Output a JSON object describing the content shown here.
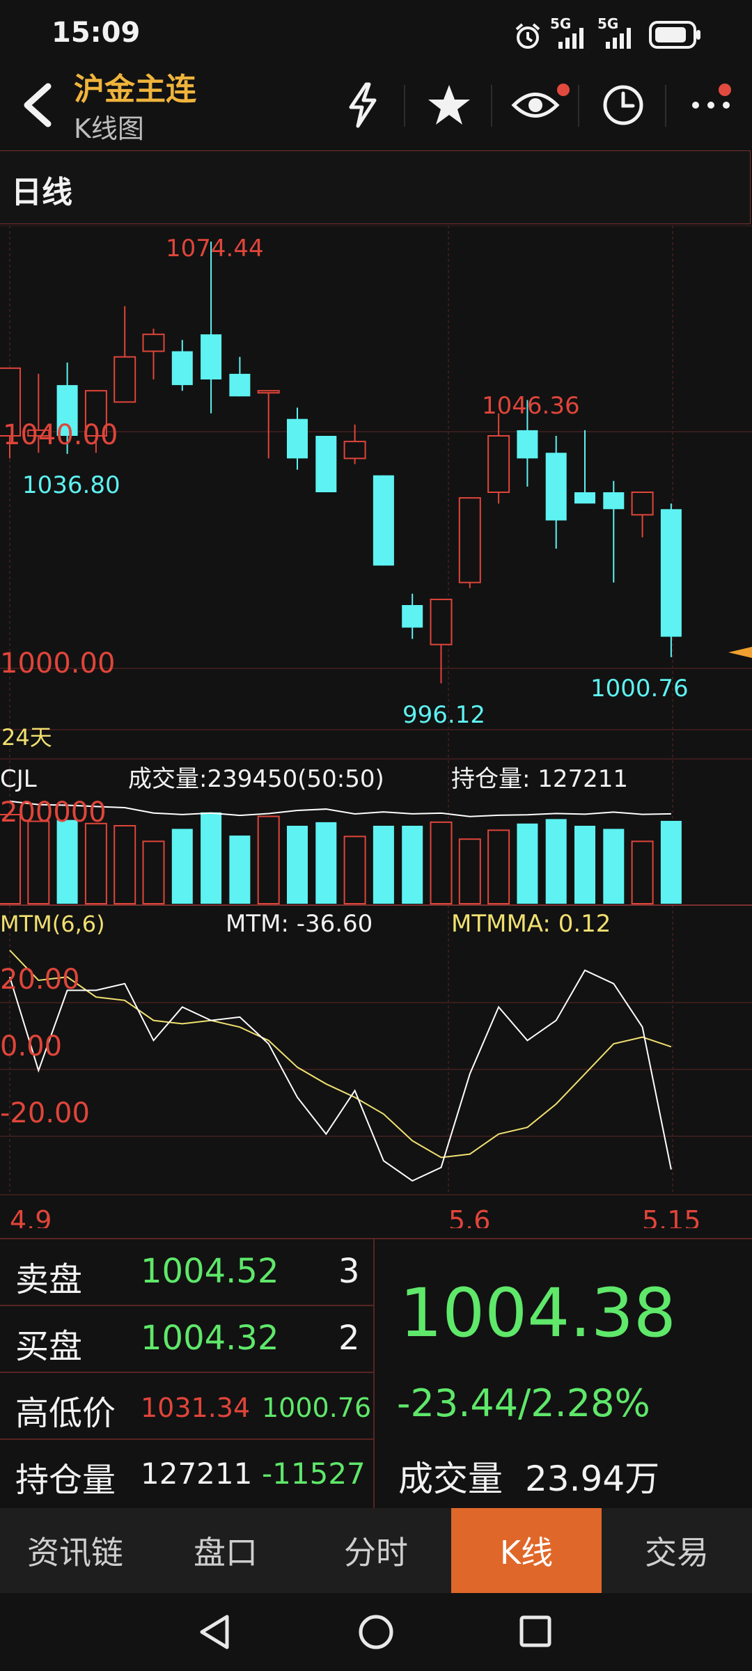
{
  "status_bar": {
    "time": "15:09",
    "network_1": "5G",
    "network_2": "5G"
  },
  "header": {
    "title": "沪金主连",
    "subtitle": "K线图",
    "icons": [
      "back-icon",
      "flash-icon",
      "star-icon",
      "eye-icon",
      "clock-icon",
      "more-icon"
    ]
  },
  "period": {
    "label": "日线"
  },
  "chart": {
    "price_labels": {
      "high": "1074.44",
      "level_1040": "1040.00",
      "low_left": "1036.80",
      "high2": "1046.36",
      "level_1000": "1000.00",
      "low": "996.12",
      "last_low": "1000.76"
    },
    "days_label": "24天",
    "volume": {
      "name": "CJL",
      "volume_text": "成交量:239450(50:50)",
      "oi_text": "持仓量: 127211",
      "axis_label": "200000"
    },
    "mtm": {
      "name": "MTM(6,6)",
      "mtm_text": "MTM: -36.60",
      "mtmma_text": "MTMMA: 0.12",
      "ticks": [
        "20.00",
        "0.00",
        "-20.00"
      ]
    },
    "date_labels": [
      "4.9",
      "5.6",
      "5.15"
    ]
  },
  "chart_data": {
    "type": "candlestick",
    "ohlc": [
      {
        "o": 1040,
        "h": 1045,
        "l": 1036,
        "c": 1052
      },
      {
        "o": 1040,
        "h": 1051,
        "l": 1037,
        "c": 1041
      },
      {
        "o": 1049,
        "h": 1053,
        "l": 1036.8,
        "c": 1040
      },
      {
        "o": 1040,
        "h": 1047,
        "l": 1037,
        "c": 1048
      },
      {
        "o": 1046,
        "h": 1063,
        "l": 1046,
        "c": 1054
      },
      {
        "o": 1055,
        "h": 1059,
        "l": 1050,
        "c": 1058
      },
      {
        "o": 1055,
        "h": 1057,
        "l": 1048,
        "c": 1049
      },
      {
        "o": 1058,
        "h": 1074.44,
        "l": 1044,
        "c": 1050
      },
      {
        "o": 1051,
        "h": 1054,
        "l": 1047,
        "c": 1047
      },
      {
        "o": 1048,
        "h": 1048,
        "l": 1036,
        "c": 1048
      },
      {
        "o": 1043,
        "h": 1045,
        "l": 1034,
        "c": 1036
      },
      {
        "o": 1040,
        "h": 1040,
        "l": 1030,
        "c": 1030
      },
      {
        "o": 1036,
        "h": 1042,
        "l": 1035,
        "c": 1039
      },
      {
        "o": 1033,
        "h": 1033,
        "l": 1017,
        "c": 1017
      },
      {
        "o": 1010,
        "h": 1012,
        "l": 1004,
        "c": 1006
      },
      {
        "o": 1003,
        "h": 1011,
        "l": 996.12,
        "c": 1011
      },
      {
        "o": 1014,
        "h": 1029,
        "l": 1013,
        "c": 1029
      },
      {
        "o": 1030,
        "h": 1044,
        "l": 1028,
        "c": 1040
      },
      {
        "o": 1041,
        "h": 1046.36,
        "l": 1031,
        "c": 1036
      },
      {
        "o": 1037,
        "h": 1040,
        "l": 1020,
        "c": 1025
      },
      {
        "o": 1030,
        "h": 1041,
        "l": 1029,
        "c": 1028
      },
      {
        "o": 1030,
        "h": 1032,
        "l": 1014,
        "c": 1027
      },
      {
        "o": 1026,
        "h": 1030,
        "l": 1022,
        "c": 1030
      },
      {
        "o": 1027,
        "h": 1028,
        "l": 1000.76,
        "c": 1004.38
      }
    ],
    "volume": [
      200000,
      185000,
      188000,
      180000,
      175000,
      140000,
      168000,
      205000,
      153000,
      196000,
      175000,
      183000,
      151000,
      175000,
      175000,
      183000,
      145000,
      165000,
      180000,
      190000,
      175000,
      168000,
      140000,
      186000
    ],
    "mtm": [
      21,
      -7,
      17,
      17,
      19,
      2,
      12,
      8,
      9,
      1,
      -15,
      -26,
      -13,
      -34,
      -40,
      -36,
      -8,
      12,
      2,
      8,
      23,
      19,
      6,
      -36.6
    ],
    "mtmma": [
      29,
      20,
      21,
      15,
      14,
      8,
      7,
      8,
      6,
      2,
      -6,
      -11,
      -15,
      -20,
      -28,
      -33,
      -32,
      -26,
      -24,
      -17,
      -8,
      1,
      3,
      0.12
    ]
  },
  "quote": {
    "sell": {
      "label": "卖盘",
      "price": "1004.52",
      "qty": "3"
    },
    "buy": {
      "label": "买盘",
      "price": "1004.32",
      "qty": "2"
    },
    "hilo": {
      "label": "高低价",
      "high": "1031.34",
      "low": "1000.76"
    },
    "oi": {
      "label": "持仓量",
      "value": "127211",
      "change": "-11527"
    },
    "last_price": "1004.38",
    "change": "-23.44/2.28%",
    "volume_label": "成交量",
    "volume_value": "23.94万"
  },
  "tabs": [
    "资讯链",
    "盘口",
    "分时",
    "K线",
    "交易"
  ],
  "active_tab": 3,
  "colors": {
    "up": "#e0453a",
    "down": "#5ef2f2",
    "accent": "#e0672a",
    "price_green": "#5fe86a",
    "title": "#f0b43c",
    "mtmma": "#f0e070"
  }
}
